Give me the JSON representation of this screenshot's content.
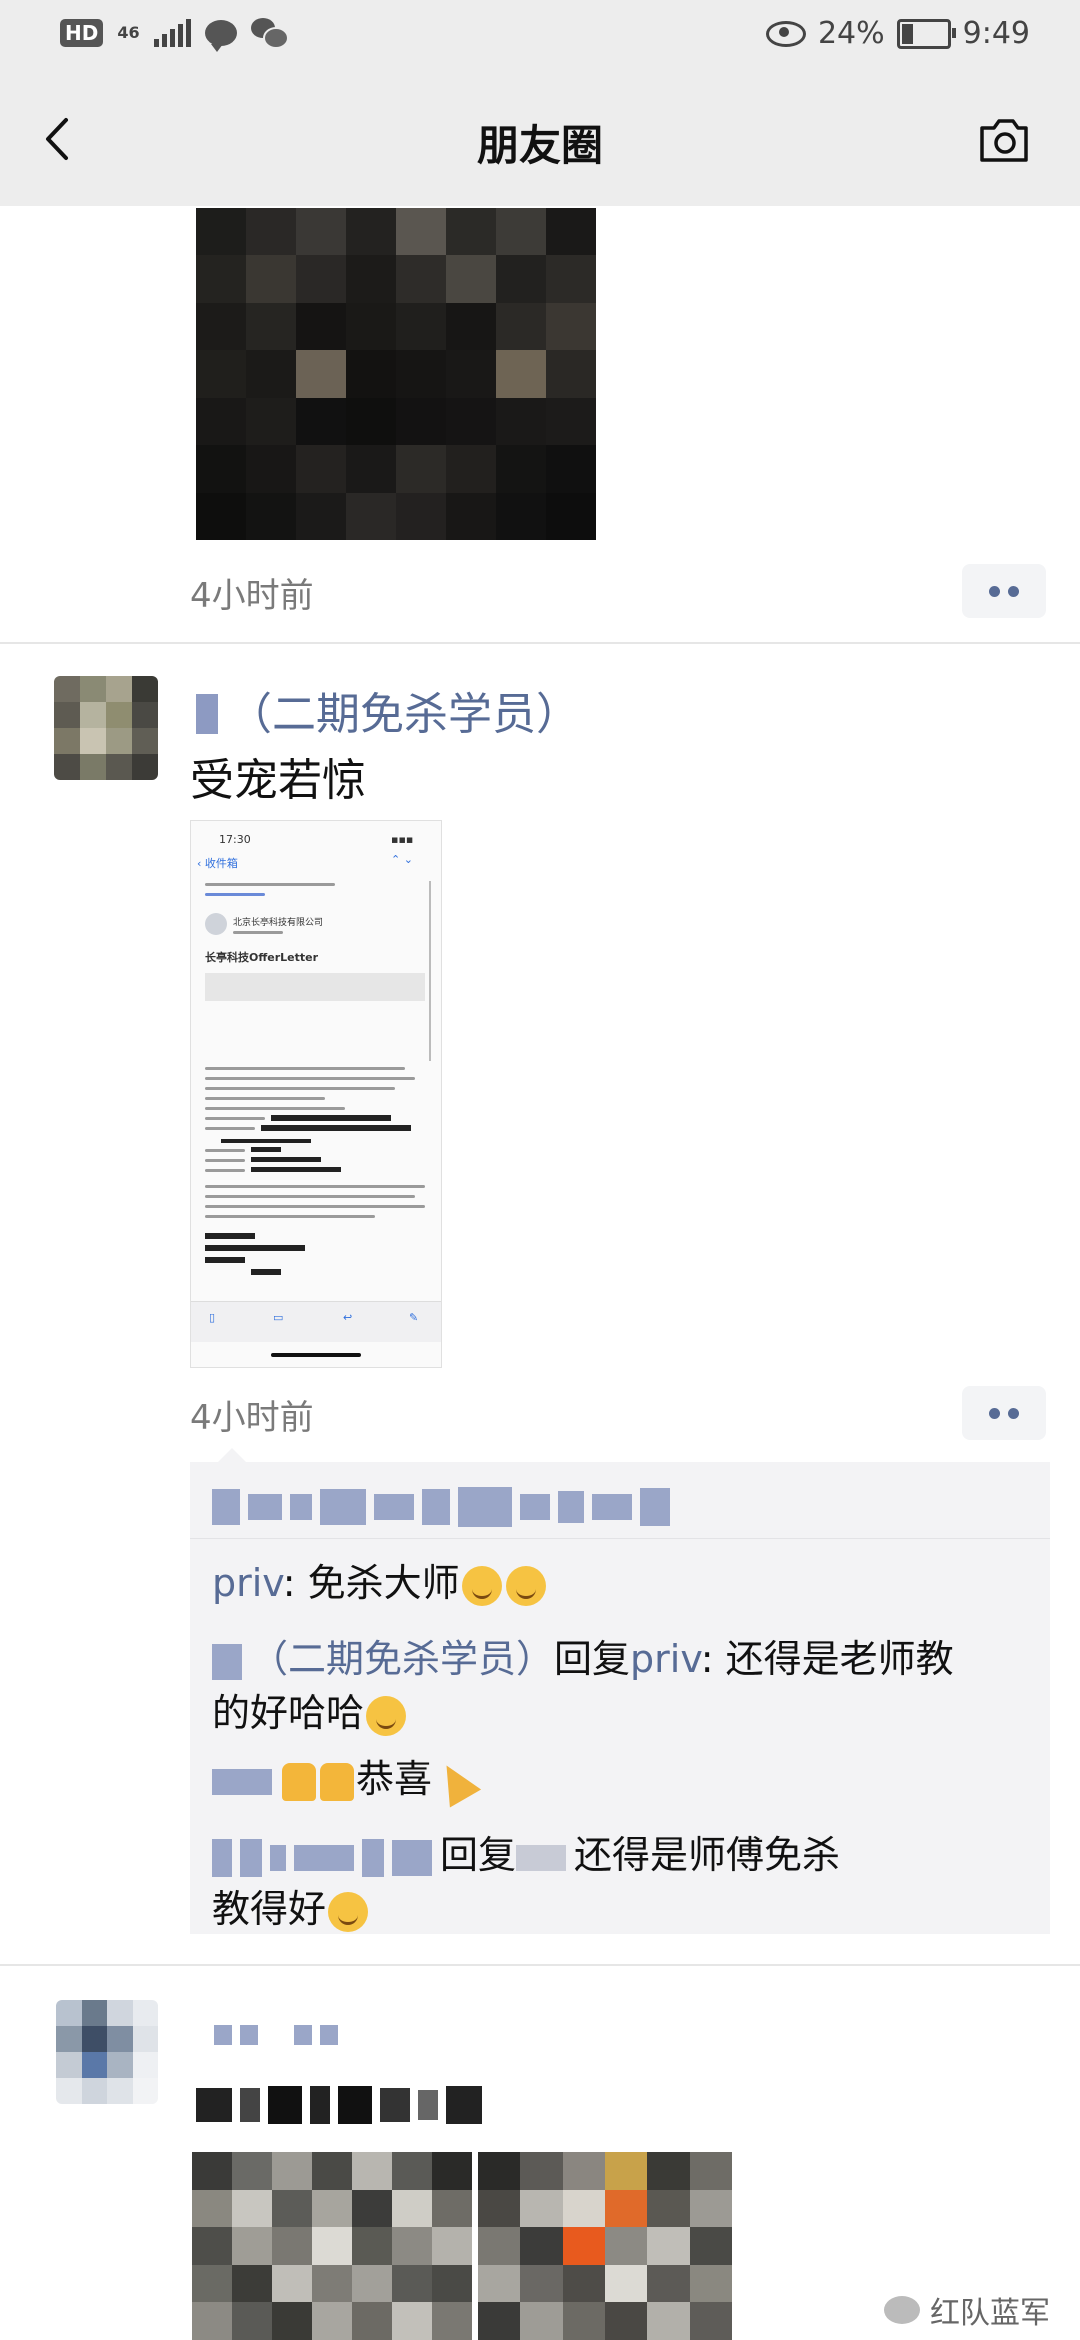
{
  "status_bar": {
    "hd_label": "HD",
    "network_label": "46",
    "battery_percent": "24%",
    "battery_level": 0.24,
    "time": "9:49"
  },
  "nav": {
    "title": "朋友圈",
    "back_icon": "chevron-left-icon",
    "camera_icon": "camera-icon"
  },
  "posts": [
    {
      "timestamp": "4小时前"
    },
    {
      "author_suffix": "（二期免杀学员）",
      "text": "受宠若惊",
      "timestamp": "4小时前",
      "screenshot": {
        "time": "17:30",
        "back_label": "‹ 收件箱",
        "sender": "北京长亭科技有限公司",
        "subject": "长亭科技OfferLetter"
      },
      "comments": [
        {
          "name": "priv",
          "separator": ": ",
          "text": "免杀大师"
        },
        {
          "name": "（二期免杀学员）",
          "reply_word": "回复",
          "reply_to": "priv",
          "separator": ": ",
          "text": "还得是老师教",
          "text2": "的好哈哈"
        },
        {
          "text": "恭喜"
        },
        {
          "reply_word": "回复",
          "text": "还得是师傅免杀",
          "text2": "教得好"
        }
      ]
    }
  ],
  "watermark": "红队蓝军",
  "colors": {
    "link_blue": "#576b95",
    "nav_bg": "#ededed",
    "timestamp_gray": "#7a7a7a"
  }
}
